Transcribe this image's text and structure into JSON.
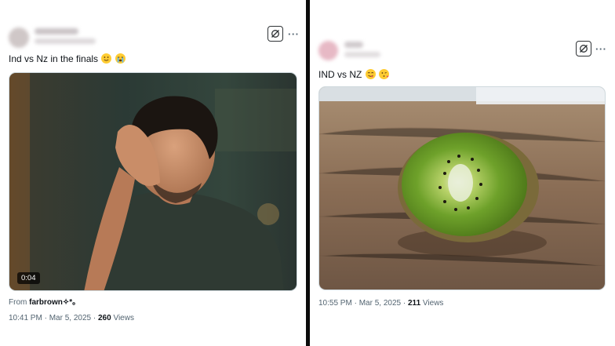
{
  "left_post": {
    "text": "Ind vs Nz in the finals",
    "emojis": [
      "slightly-smiling-face",
      "loudly-crying-face"
    ],
    "video_duration": "0:04",
    "from_prefix": "From",
    "from_account": "farbrown✧*。",
    "time": "10:41 PM",
    "date": "Mar 5, 2025",
    "views_count": "260",
    "views_label": "Views"
  },
  "right_post": {
    "text": "IND vs NZ",
    "emojis": [
      "face-savoring-food",
      "face-blowing-kiss"
    ],
    "time": "10:55 PM",
    "date": "Mar 5, 2025",
    "views_count": "211",
    "views_label": "Views"
  },
  "separator": "·",
  "icons": {
    "grok": "grok-icon",
    "more": "more-options-icon"
  },
  "more_label": "···",
  "colors": {
    "divider": "#0b0b0b",
    "text_primary": "#0f1419",
    "text_secondary": "#536471",
    "emoji_yellow": "#ffcc33"
  }
}
